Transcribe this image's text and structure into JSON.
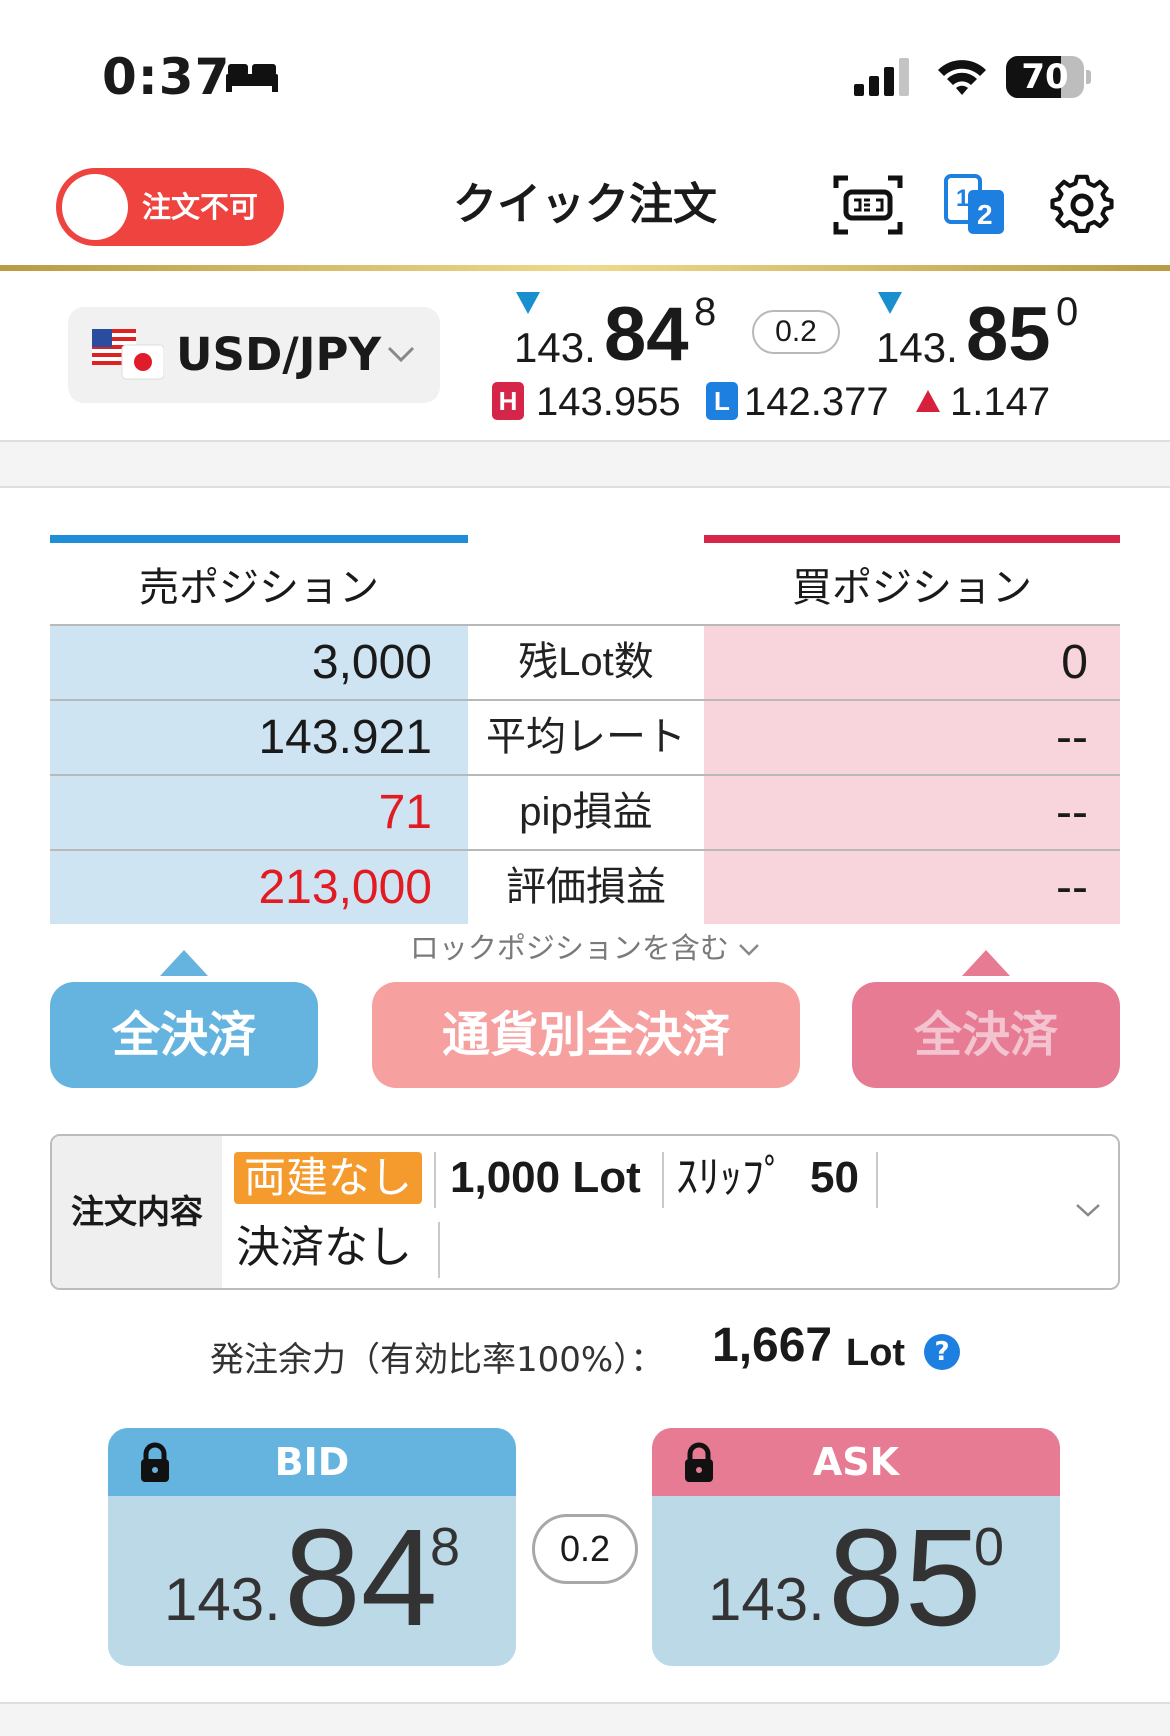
{
  "status_bar": {
    "time": "0:37",
    "battery": "70",
    "battery_level": 0.7
  },
  "header": {
    "toggle_label": "注文不可",
    "title": "クイック注文",
    "accent_color": "#ef4340",
    "icons": [
      "screen-frame-icon",
      "one-two-layout-icon",
      "gear-icon"
    ]
  },
  "rate": {
    "pair": "USD/JPY",
    "bid": {
      "base": "143.",
      "big": "84",
      "sup": "8"
    },
    "ask": {
      "base": "143.",
      "big": "85",
      "sup": "0"
    },
    "spread": "0.2",
    "high_badge": "H",
    "high": "143.955",
    "low_badge": "L",
    "low": "142.377",
    "change": "1.147"
  },
  "positions": {
    "sell_header": "売ポジション",
    "buy_header": "買ポジション",
    "rows": [
      {
        "label": "残Lot数",
        "sell": "3,000",
        "buy": "0"
      },
      {
        "label": "平均レート",
        "sell": "143.921",
        "buy": "--"
      },
      {
        "label": "pip損益",
        "sell": "71",
        "buy": "--"
      },
      {
        "label": "評価損益",
        "sell": "213,000",
        "buy": "--"
      }
    ],
    "lock_note": "ロックポジションを含む"
  },
  "buttons": {
    "sell_close_all": "全決済",
    "currency_close_all": "通貨別全決済",
    "buy_close_all": "全決済"
  },
  "order": {
    "label": "注文内容",
    "hedge_tag": "両建なし",
    "lot": "1,000 Lot",
    "slip_label": "ｽﾘｯﾌﾟ",
    "slip_value": "50",
    "settle": "決済なし"
  },
  "margin": {
    "label": "発注余力（有効比率100%）：",
    "value": "1,667",
    "unit": "Lot",
    "help": "?"
  },
  "trade": {
    "bid_label": "BID",
    "ask_label": "ASK",
    "bid": {
      "base": "143.",
      "big": "84",
      "sup": "8"
    },
    "ask": {
      "base": "143.",
      "big": "85",
      "sup": "0"
    },
    "spread": "0.2"
  },
  "colors": {
    "sell_blue": "#64b4df",
    "buy_pink": "#e77b94",
    "currency_salmon": "#f7a0a0",
    "gold": "#cdb05a"
  }
}
